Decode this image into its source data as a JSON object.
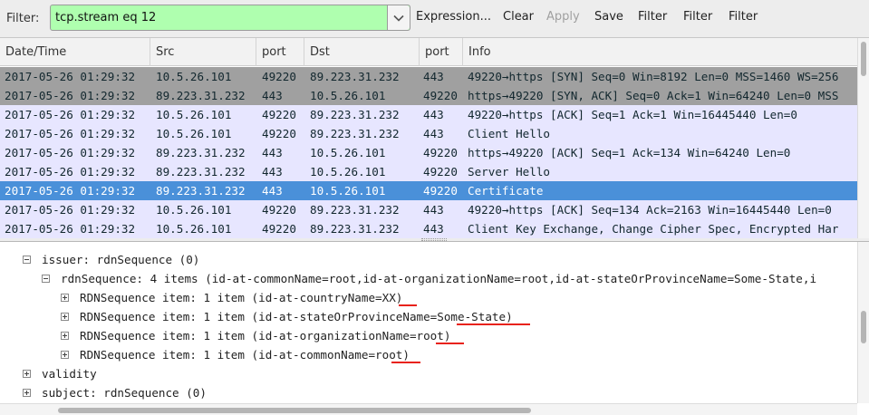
{
  "filter_bar": {
    "label": "Filter:",
    "value": "tcp.stream eq 12",
    "buttons": {
      "expression": "Expression...",
      "clear": "Clear",
      "apply": "Apply",
      "save": "Save",
      "filter1": "Filter",
      "filter2": "Filter",
      "filter3": "Filter"
    },
    "colors": {
      "valid_filter_bg": "#afffaf"
    }
  },
  "packet_list": {
    "columns": [
      "Date/Time",
      "Src",
      "port",
      "Dst",
      "port",
      "Info"
    ],
    "rows": [
      {
        "time": "2017-05-26 01:29:32",
        "src": "10.5.26.101",
        "sport": "49220",
        "dst": "89.223.31.232",
        "dport": "443",
        "info": "49220→https [SYN] Seq=0 Win=8192 Len=0 MSS=1460 WS=256"
      },
      {
        "time": "2017-05-26 01:29:32",
        "src": "89.223.31.232",
        "sport": "443",
        "dst": "10.5.26.101",
        "dport": "49220",
        "info": "https→49220 [SYN, ACK] Seq=0 Ack=1 Win=64240 Len=0 MSS"
      },
      {
        "time": "2017-05-26 01:29:32",
        "src": "10.5.26.101",
        "sport": "49220",
        "dst": "89.223.31.232",
        "dport": "443",
        "info": "49220→https [ACK] Seq=1 Ack=1 Win=16445440 Len=0"
      },
      {
        "time": "2017-05-26 01:29:32",
        "src": "10.5.26.101",
        "sport": "49220",
        "dst": "89.223.31.232",
        "dport": "443",
        "info": "Client Hello"
      },
      {
        "time": "2017-05-26 01:29:32",
        "src": "89.223.31.232",
        "sport": "443",
        "dst": "10.5.26.101",
        "dport": "49220",
        "info": "https→49220 [ACK] Seq=1 Ack=134 Win=64240 Len=0"
      },
      {
        "time": "2017-05-26 01:29:32",
        "src": "89.223.31.232",
        "sport": "443",
        "dst": "10.5.26.101",
        "dport": "49220",
        "info": "Server Hello"
      },
      {
        "time": "2017-05-26 01:29:32",
        "src": "89.223.31.232",
        "sport": "443",
        "dst": "10.5.26.101",
        "dport": "49220",
        "info": "Certificate"
      },
      {
        "time": "2017-05-26 01:29:32",
        "src": "10.5.26.101",
        "sport": "49220",
        "dst": "89.223.31.232",
        "dport": "443",
        "info": "49220→https [ACK] Seq=134 Ack=2163 Win=16445440 Len=0"
      },
      {
        "time": "2017-05-26 01:29:32",
        "src": "10.5.26.101",
        "sport": "49220",
        "dst": "89.223.31.232",
        "dport": "443",
        "info": "Client Key Exchange, Change Cipher Spec, Encrypted Har"
      }
    ],
    "colors": {
      "syn_row": "#a0a0a0",
      "tcp_row": "#e7e6ff",
      "selected_row": "#4a90d9"
    }
  },
  "details": {
    "lines": [
      "issuer: rdnSequence (0)",
      "rdnSequence: 4 items (id-at-commonName=root,id-at-organizationName=root,id-at-stateOrProvinceName=Some-State,i",
      "RDNSequence item: 1 item (id-at-countryName=XX)",
      "RDNSequence item: 1 item (id-at-stateOrProvinceName=Some-State)",
      "RDNSequence item: 1 item (id-at-organizationName=root)",
      "RDNSequence item: 1 item (id-at-commonName=root)",
      "validity",
      "subject: rdnSequence (0)"
    ],
    "highlight_color": "#e8221a"
  }
}
